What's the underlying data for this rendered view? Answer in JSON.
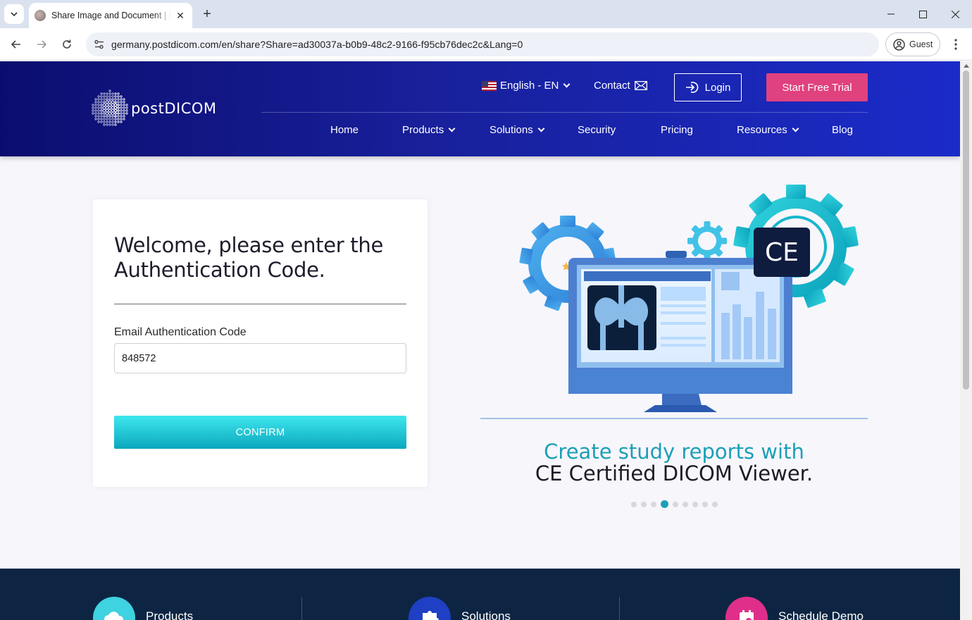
{
  "browser": {
    "tab_title": "Share Image and Document | PostDICOM",
    "url": "germany.postdicom.com/en/share?Share=ad30037a-b0b9-48c2-9166-f95cb76dec2c&Lang=0",
    "profile_label": "Guest"
  },
  "header": {
    "logo_text": "postDICOM",
    "language_label": "English - EN",
    "contact_label": "Contact",
    "login_label": "Login",
    "trial_label": "Start Free Trial",
    "nav": [
      {
        "label": "Home"
      },
      {
        "label": "Products"
      },
      {
        "label": "Solutions"
      },
      {
        "label": "Security"
      },
      {
        "label": "Pricing"
      },
      {
        "label": "Resources"
      },
      {
        "label": "Blog"
      }
    ]
  },
  "auth": {
    "title": "Welcome, please enter the Authentication Code.",
    "field_label": "Email Authentication Code",
    "field_value": "848572",
    "confirm_label": "CONFIRM"
  },
  "carousel": {
    "badge_text": "CE",
    "caption_line1": "Create study reports with",
    "caption_line2": "CE Certified DICOM Viewer.",
    "slide_count": 9,
    "active_index": 3
  },
  "footer": {
    "items": [
      {
        "label": "Products"
      },
      {
        "label": "Solutions"
      },
      {
        "label": "Schedule Demo"
      }
    ]
  },
  "colors": {
    "header_start": "#0b0d6e",
    "header_end": "#1b2bc8",
    "trial_button": "#e0417f",
    "confirm_button": "#0ba7bd",
    "caption_accent": "#1c9fb8",
    "footer_band": "#0d2543"
  }
}
